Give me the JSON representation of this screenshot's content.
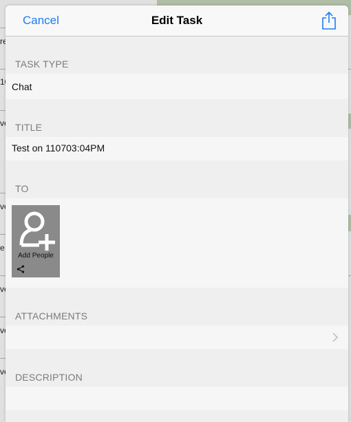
{
  "navbar": {
    "cancel_label": "Cancel",
    "title": "Edit Task",
    "share_icon": "share-icon"
  },
  "sections": {
    "task_type": {
      "header": "TASK TYPE",
      "value": "Chat"
    },
    "title": {
      "header": "TITLE",
      "value": "Test on 110703:04PM"
    },
    "to": {
      "header": "TO",
      "add_people_label": "Add People",
      "add_icon": "add-person-icon"
    },
    "attachments": {
      "header": "ATTACHMENTS",
      "chevron_icon": "chevron-right-icon"
    },
    "description": {
      "header": "DESCRIPTION",
      "value": ""
    }
  },
  "background": {
    "fragments": [
      "re",
      "10",
      "ve",
      "ve",
      "e",
      "ve",
      "ve",
      "ve"
    ]
  },
  "colors": {
    "accent": "#1a7cf5",
    "section_header": "#7b7b7b",
    "sheet_background": "#efefef",
    "row_background": "#f6f6f6"
  }
}
